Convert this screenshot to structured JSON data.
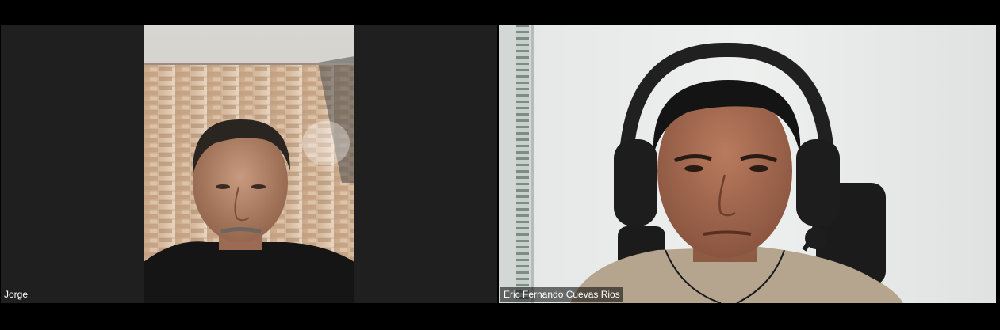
{
  "meeting": {
    "participants": [
      {
        "name": "Jorge"
      },
      {
        "name": "Eric Fernando Cuevas Rios"
      }
    ]
  },
  "colors": {
    "background": "#000000",
    "tile_background": "#1f1f1f",
    "name_text": "#ffffff"
  }
}
